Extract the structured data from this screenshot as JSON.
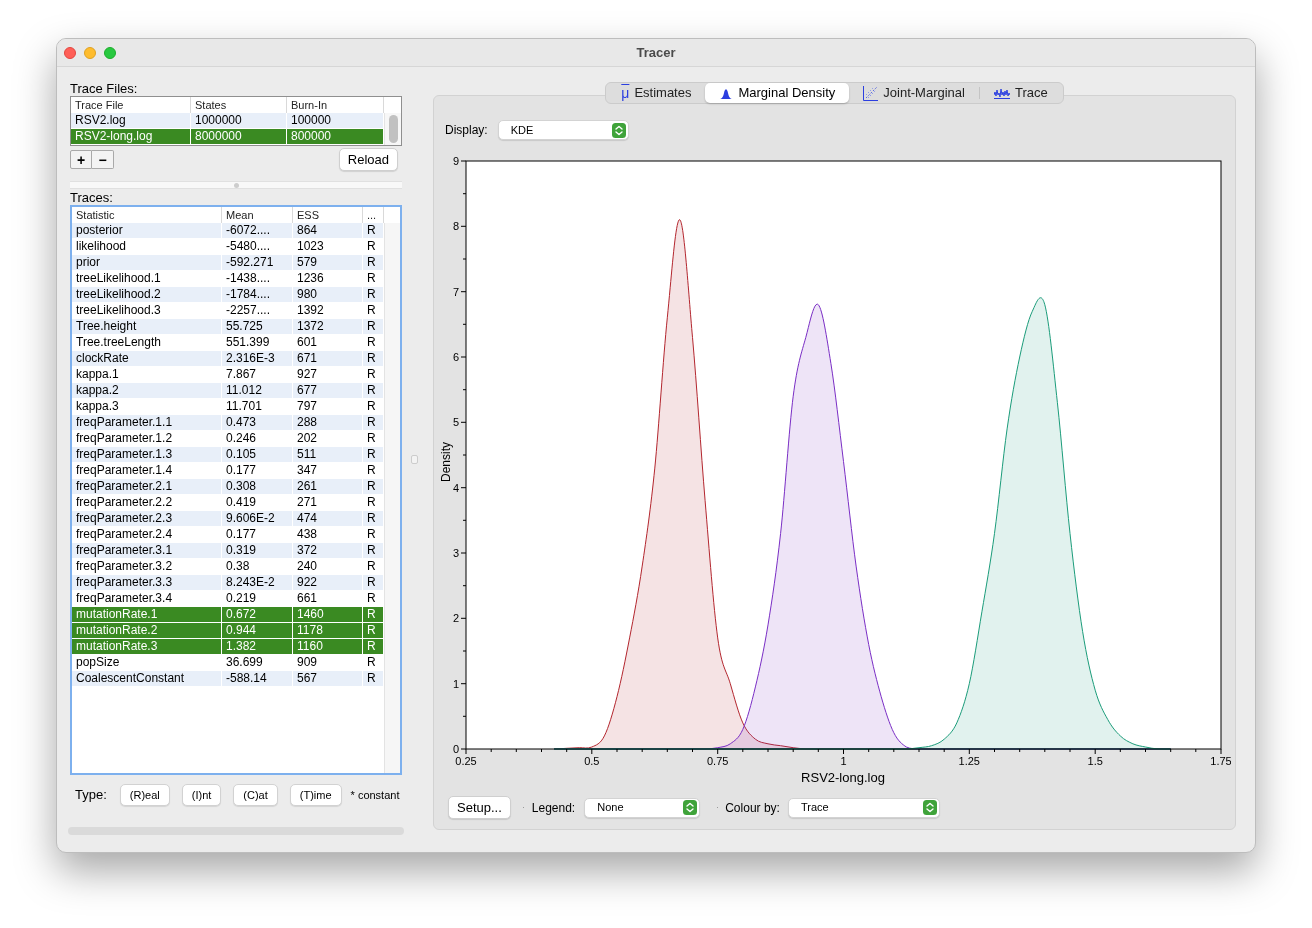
{
  "window": {
    "title": "Tracer"
  },
  "trace_files": {
    "label": "Trace Files:",
    "columns": [
      "Trace File",
      "States",
      "Burn-In"
    ],
    "rows": [
      {
        "cells": [
          "RSV2.log",
          "1000000",
          "100000"
        ],
        "selected": false
      },
      {
        "cells": [
          "RSV2-long.log",
          "8000000",
          "800000"
        ],
        "selected": true
      }
    ],
    "buttons": [
      "+",
      "−"
    ],
    "reload_button": "Reload"
  },
  "traces": {
    "label": "Traces:",
    "columns": [
      "Statistic",
      "Mean",
      "ESS",
      "..."
    ],
    "rows": [
      {
        "cells": [
          "posterior",
          "-6072....",
          "864",
          "R"
        ],
        "selected": false
      },
      {
        "cells": [
          "likelihood",
          "-5480....",
          "1023",
          "R"
        ],
        "selected": false
      },
      {
        "cells": [
          "prior",
          "-592.271",
          "579",
          "R"
        ],
        "selected": false
      },
      {
        "cells": [
          "treeLikelihood.1",
          "-1438....",
          "1236",
          "R"
        ],
        "selected": false
      },
      {
        "cells": [
          "treeLikelihood.2",
          "-1784....",
          "980",
          "R"
        ],
        "selected": false
      },
      {
        "cells": [
          "treeLikelihood.3",
          "-2257....",
          "1392",
          "R"
        ],
        "selected": false
      },
      {
        "cells": [
          "Tree.height",
          "55.725",
          "1372",
          "R"
        ],
        "selected": false
      },
      {
        "cells": [
          "Tree.treeLength",
          "551.399",
          "601",
          "R"
        ],
        "selected": false
      },
      {
        "cells": [
          "clockRate",
          "2.316E-3",
          "671",
          "R"
        ],
        "selected": false
      },
      {
        "cells": [
          "kappa.1",
          "7.867",
          "927",
          "R"
        ],
        "selected": false
      },
      {
        "cells": [
          "kappa.2",
          "11.012",
          "677",
          "R"
        ],
        "selected": false
      },
      {
        "cells": [
          "kappa.3",
          "11.701",
          "797",
          "R"
        ],
        "selected": false
      },
      {
        "cells": [
          "freqParameter.1.1",
          "0.473",
          "288",
          "R"
        ],
        "selected": false
      },
      {
        "cells": [
          "freqParameter.1.2",
          "0.246",
          "202",
          "R"
        ],
        "selected": false
      },
      {
        "cells": [
          "freqParameter.1.3",
          "0.105",
          "511",
          "R"
        ],
        "selected": false
      },
      {
        "cells": [
          "freqParameter.1.4",
          "0.177",
          "347",
          "R"
        ],
        "selected": false
      },
      {
        "cells": [
          "freqParameter.2.1",
          "0.308",
          "261",
          "R"
        ],
        "selected": false
      },
      {
        "cells": [
          "freqParameter.2.2",
          "0.419",
          "271",
          "R"
        ],
        "selected": false
      },
      {
        "cells": [
          "freqParameter.2.3",
          "9.606E-2",
          "474",
          "R"
        ],
        "selected": false
      },
      {
        "cells": [
          "freqParameter.2.4",
          "0.177",
          "438",
          "R"
        ],
        "selected": false
      },
      {
        "cells": [
          "freqParameter.3.1",
          "0.319",
          "372",
          "R"
        ],
        "selected": false
      },
      {
        "cells": [
          "freqParameter.3.2",
          "0.38",
          "240",
          "R"
        ],
        "selected": false
      },
      {
        "cells": [
          "freqParameter.3.3",
          "8.243E-2",
          "922",
          "R"
        ],
        "selected": false
      },
      {
        "cells": [
          "freqParameter.3.4",
          "0.219",
          "661",
          "R"
        ],
        "selected": false
      },
      {
        "cells": [
          "mutationRate.1",
          "0.672",
          "1460",
          "R"
        ],
        "selected": true
      },
      {
        "cells": [
          "mutationRate.2",
          "0.944",
          "1178",
          "R"
        ],
        "selected": true
      },
      {
        "cells": [
          "mutationRate.3",
          "1.382",
          "1160",
          "R"
        ],
        "selected": true
      },
      {
        "cells": [
          "popSize",
          "36.699",
          "909",
          "R"
        ],
        "selected": false
      },
      {
        "cells": [
          "CoalescentConstant",
          "-588.14",
          "567",
          "R"
        ],
        "selected": false
      }
    ]
  },
  "type_bar": {
    "label": "Type:",
    "buttons": [
      "(R)eal",
      "(I)nt",
      "(C)at",
      "(T)ime"
    ],
    "note": "* constant"
  },
  "tabs": [
    {
      "label": "Estimates",
      "symbol": "μ",
      "selected": false
    },
    {
      "label": "Marginal Density",
      "selected": true
    },
    {
      "label": "Joint-Marginal",
      "selected": false
    },
    {
      "label": "Trace",
      "selected": false
    }
  ],
  "display": {
    "label": "Display:",
    "value": "KDE"
  },
  "plot": {
    "chart_data": {
      "type": "area",
      "xlabel": "RSV2-long.log",
      "ylabel": "Density",
      "x": [
        0.425,
        0.45,
        0.475,
        0.5,
        0.525,
        0.55,
        0.575,
        0.6,
        0.625,
        0.65,
        0.675,
        0.7,
        0.725,
        0.75,
        0.775,
        0.8,
        0.825,
        0.85,
        0.875,
        0.9,
        0.925,
        0.95,
        0.975,
        1.0,
        1.025,
        1.05,
        1.075,
        1.1,
        1.125,
        1.15,
        1.175,
        1.2,
        1.225,
        1.25,
        1.275,
        1.3,
        1.325,
        1.35,
        1.375,
        1.4,
        1.425,
        1.45,
        1.475,
        1.5,
        1.525,
        1.55,
        1.575,
        1.6,
        1.625,
        1.65
      ],
      "series": [
        {
          "color": "#b3262e",
          "values": [
            0,
            0.01,
            0.02,
            0.03,
            0.2,
            0.8,
            1.7,
            2.8,
            4.3,
            6.6,
            8.1,
            6.3,
            3.8,
            1.7,
            1.0,
            0.4,
            0.15,
            0.08,
            0.05,
            0.02,
            0,
            0,
            0,
            0,
            0,
            0,
            0,
            0,
            0,
            0,
            0,
            0,
            0,
            0,
            0,
            0,
            0,
            0,
            0,
            0,
            0,
            0,
            0,
            0,
            0,
            0,
            0,
            0,
            0,
            0
          ]
        },
        {
          "color": "#7a2ec5",
          "values": [
            0,
            0,
            0,
            0,
            0,
            0,
            0,
            0,
            0,
            0,
            0,
            0,
            0,
            0.02,
            0.08,
            0.3,
            0.95,
            1.9,
            3.3,
            5.4,
            6.3,
            6.8,
            5.9,
            4.4,
            2.8,
            1.6,
            0.8,
            0.25,
            0.03,
            0,
            0,
            0,
            0,
            0,
            0,
            0,
            0,
            0,
            0,
            0,
            0,
            0,
            0,
            0,
            0,
            0,
            0,
            0,
            0,
            0
          ]
        },
        {
          "color": "#1b9c7a",
          "values": [
            0,
            0,
            0,
            0,
            0,
            0,
            0,
            0,
            0,
            0,
            0,
            0,
            0,
            0,
            0,
            0,
            0,
            0,
            0,
            0,
            0,
            0,
            0,
            0,
            0,
            0,
            0,
            0,
            0,
            0.02,
            0.05,
            0.15,
            0.4,
            1.0,
            2.1,
            3.3,
            4.9,
            6.0,
            6.7,
            6.8,
            5.3,
            3.3,
            1.8,
            0.9,
            0.45,
            0.2,
            0.08,
            0.03,
            0,
            0
          ]
        }
      ],
      "xlim": [
        0.25,
        1.75
      ],
      "ylim": [
        0,
        9
      ],
      "xticks": [
        0.25,
        0.5,
        0.75,
        1,
        1.25,
        1.5,
        1.75
      ],
      "yticks": [
        0,
        1,
        2,
        3,
        4,
        5,
        6,
        7,
        8,
        9
      ]
    }
  },
  "setup_button": "Setup...",
  "legend": {
    "label": "Legend:",
    "value": "None"
  },
  "colour_by": {
    "label": "Colour by:",
    "value": "Trace"
  }
}
